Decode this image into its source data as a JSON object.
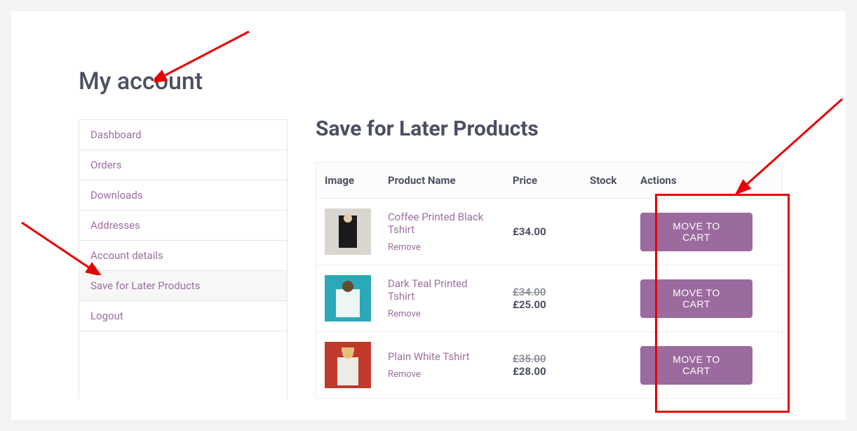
{
  "page_title": "My account",
  "sidebar": {
    "items": [
      {
        "label": "Dashboard",
        "active": false
      },
      {
        "label": "Orders",
        "active": false
      },
      {
        "label": "Downloads",
        "active": false
      },
      {
        "label": "Addresses",
        "active": false
      },
      {
        "label": "Account details",
        "active": false
      },
      {
        "label": "Save for Later Products",
        "active": true
      },
      {
        "label": "Logout",
        "active": false
      }
    ]
  },
  "section_title": "Save for Later Products",
  "table": {
    "headers": {
      "image": "Image",
      "product_name": "Product Name",
      "price": "Price",
      "stock": "Stock",
      "actions": "Actions"
    },
    "remove_label": "Remove",
    "move_label_line1": "MOVE TO",
    "move_label_line2": "CART",
    "rows": [
      {
        "name": "Coffee Printed Black Tshirt",
        "old_price": "",
        "price": "£34.00",
        "stock": "",
        "thumb": "black"
      },
      {
        "name": "Dark Teal Printed Tshirt",
        "old_price": "£34.00",
        "price": "£25.00",
        "stock": "",
        "thumb": "teal"
      },
      {
        "name": "Plain White Tshirt",
        "old_price": "£35.00",
        "price": "£28.00",
        "stock": "",
        "thumb": "white"
      }
    ]
  },
  "colors": {
    "accent": "#9b6a9e",
    "link": "#9c6da0",
    "text": "#4c5061",
    "annotation": "#e60000"
  }
}
